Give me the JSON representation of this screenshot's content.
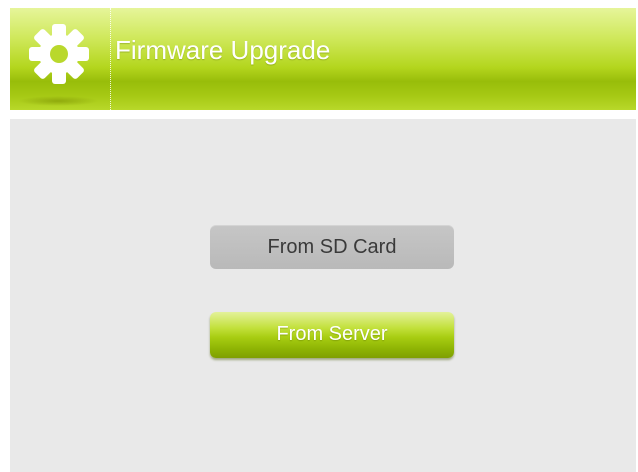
{
  "header": {
    "title": "Firmware Upgrade",
    "icon": "gear-icon"
  },
  "buttons": {
    "sd_card": "From SD Card",
    "server": "From Server"
  },
  "colors": {
    "accent": "#a8cd12",
    "background": "#e9e9e9",
    "button_disabled": "#bdbdbd"
  }
}
